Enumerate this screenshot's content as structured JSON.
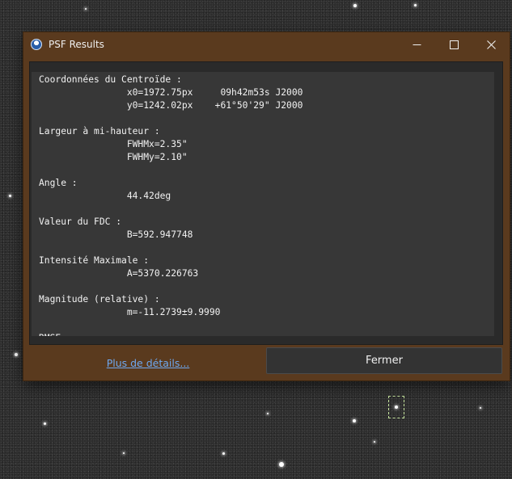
{
  "window": {
    "title": "PSF Results",
    "icon": "siril-app-icon",
    "controls": [
      "minimize-icon",
      "maximize-icon",
      "close-icon"
    ]
  },
  "results": {
    "lines": [
      "Coordonnées du Centroïde :",
      "                x0=1972.75px     09h42m53s J2000",
      "                y0=1242.02px    +61°50'29\" J2000",
      "",
      "Largeur à mi-hauteur :",
      "                FWHMx=2.35\"",
      "                FWHMy=2.10\"",
      "",
      "Angle :",
      "                44.42deg",
      "",
      "Valeur du FDC :",
      "                B=592.947748",
      "",
      "Intensité Maximale :",
      "                A=5370.226763",
      "",
      "Magnitude (relative) :",
      "                m=-11.2739±9.9990",
      "",
      "RMSE :"
    ]
  },
  "footer": {
    "details_link": "Plus de détails...",
    "close_label": "Fermer"
  }
}
